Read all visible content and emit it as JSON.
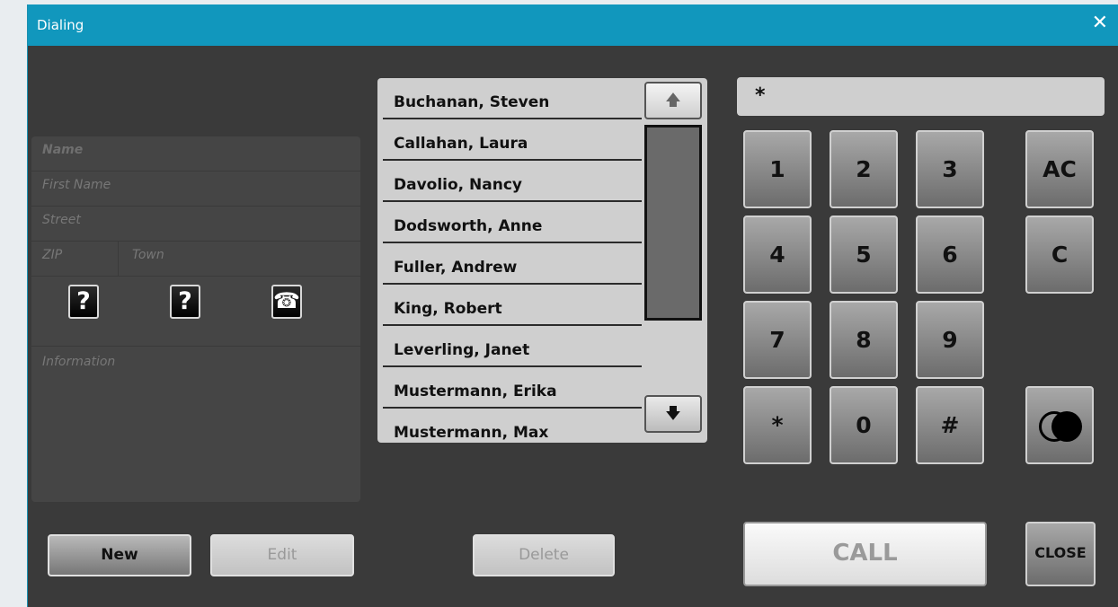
{
  "window": {
    "title": "Dialing",
    "close_glyph": "✕"
  },
  "details": {
    "name_placeholder": "Name",
    "first_name_placeholder": "First Name",
    "street_placeholder": "Street",
    "zip_placeholder": "ZIP",
    "town_placeholder": "Town",
    "information_placeholder": "Information",
    "icons": [
      "question-icon",
      "question-icon",
      "telephone-icon"
    ],
    "question_glyph": "?",
    "phone_glyph": "☎"
  },
  "contacts": [
    "Buchanan, Steven",
    "Callahan, Laura",
    "Davolio, Nancy",
    "Dodsworth, Anne",
    "Fuller, Andrew",
    "King, Robert",
    "Leverling, Janet",
    "Mustermann, Erika",
    "Mustermann, Max"
  ],
  "scroll": {
    "up_glyph": "🡅",
    "down_glyph": "🡇"
  },
  "dial": {
    "value": "*"
  },
  "keypad": {
    "k1": "1",
    "k2": "2",
    "k3": "3",
    "kAC": "AC",
    "k4": "4",
    "k5": "5",
    "k6": "6",
    "kC": "C",
    "k7": "7",
    "k8": "8",
    "k9": "9",
    "kstar": "*",
    "k0": "0",
    "khash": "#"
  },
  "buttons": {
    "new": "New",
    "edit": "Edit",
    "delete": "Delete",
    "call": "CALL",
    "close": "CLOSE"
  }
}
